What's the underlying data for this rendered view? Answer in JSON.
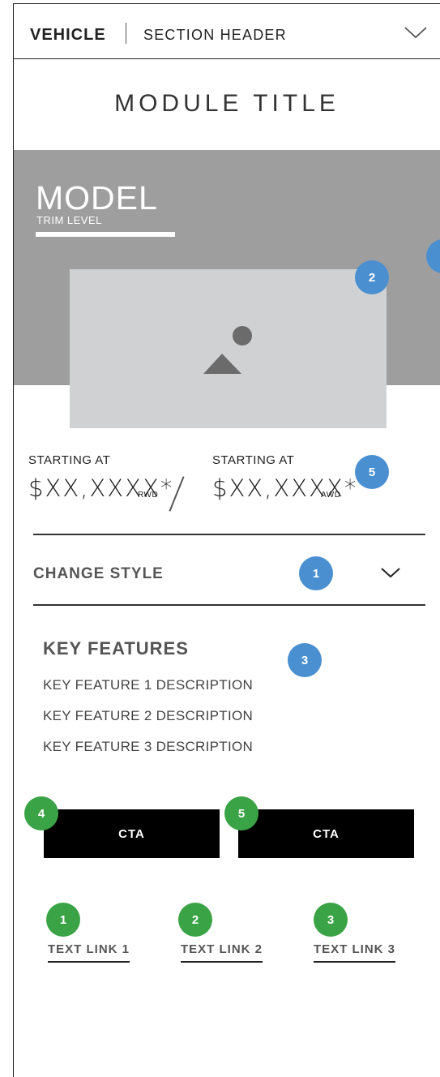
{
  "section_header": {
    "vehicle": "VEHICLE",
    "title": "SECTION HEADER",
    "toggle_icon": "chevron-down-icon"
  },
  "module": {
    "title": "MODULE TITLE"
  },
  "hero": {
    "model": "MODEL",
    "trim": "TRIM LEVEL",
    "image_icon": "image-placeholder-icon",
    "band_color": "#9e9e9e"
  },
  "pricing": {
    "rwd": {
      "label": "STARTING AT",
      "price": "$XX,XXXX*",
      "suffix": "RWD"
    },
    "separator": "/",
    "awd": {
      "label": "STARTING AT",
      "price": "$XX,XXXX*",
      "suffix": "AWD"
    }
  },
  "style_selector": {
    "label": "CHANGE STYLE",
    "icon": "chevron-down-icon"
  },
  "key_features": {
    "title": "KEY FEATURES",
    "items": [
      "KEY FEATURE 1 DESCRIPTION",
      "KEY FEATURE 2 DESCRIPTION",
      "KEY FEATURE 3 DESCRIPTION"
    ]
  },
  "ctas": [
    {
      "label": "CTA"
    },
    {
      "label": "CTA"
    }
  ],
  "text_links": [
    {
      "label": "TEXT LINK 1"
    },
    {
      "label": "TEXT LINK 2"
    },
    {
      "label": "TEXT LINK 3"
    }
  ],
  "annotations": {
    "blue": [
      "2",
      "5",
      "1",
      "3"
    ],
    "green": [
      "4",
      "5",
      "1",
      "2",
      "3"
    ],
    "colors": {
      "blue": "#4a8fd0",
      "green": "#3aa346"
    }
  }
}
